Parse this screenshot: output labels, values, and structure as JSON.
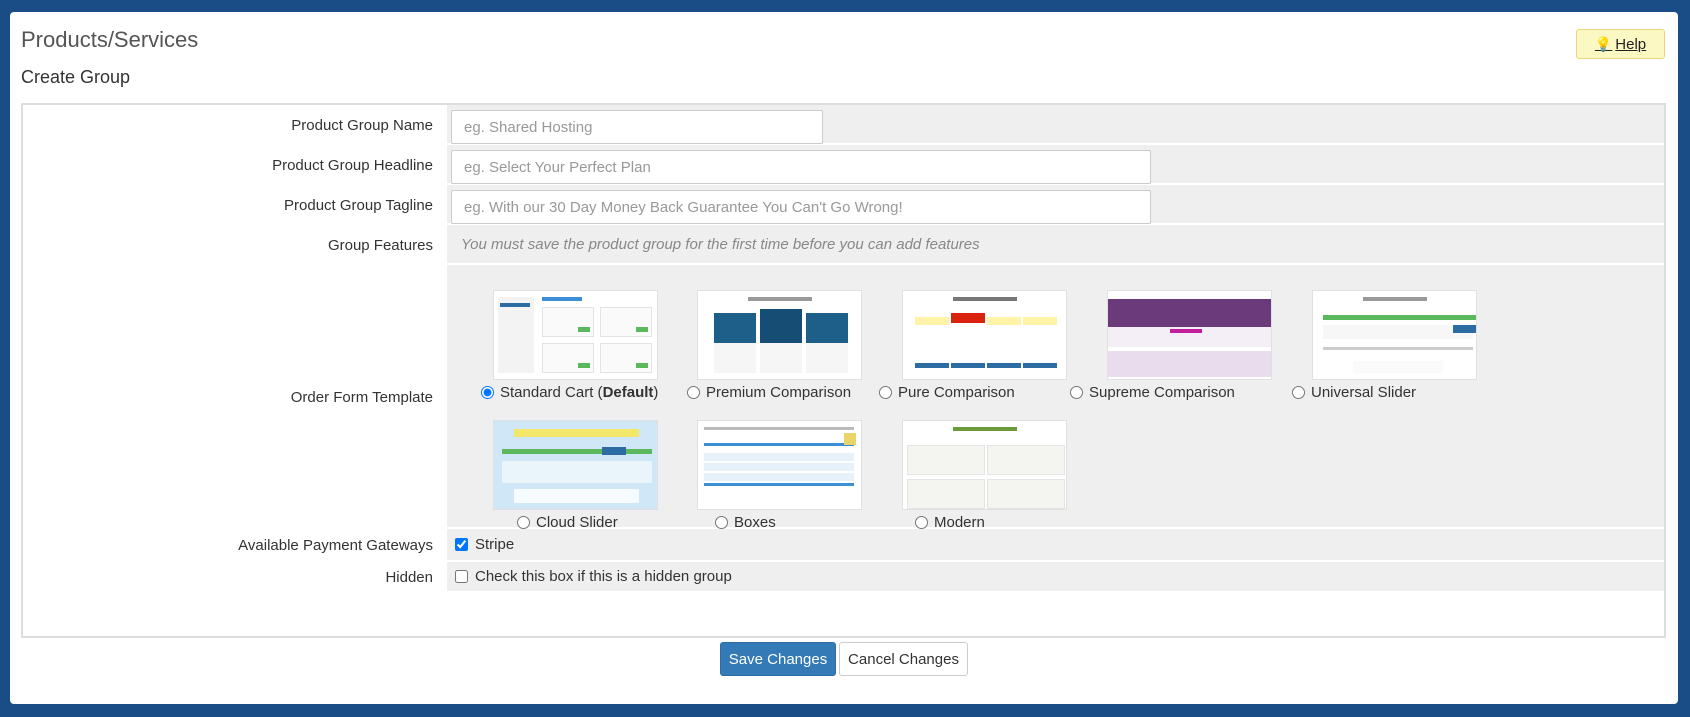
{
  "page": {
    "title": "Products/Services",
    "section_title": "Create Group"
  },
  "help": {
    "label": "Help",
    "icon": "lightbulb-icon"
  },
  "form": {
    "group_name": {
      "label": "Product Group Name",
      "value": "",
      "placeholder": "eg. Shared Hosting"
    },
    "headline": {
      "label": "Product Group Headline",
      "value": "",
      "placeholder": "eg. Select Your Perfect Plan"
    },
    "tagline": {
      "label": "Product Group Tagline",
      "value": "",
      "placeholder": "eg. With our 30 Day Money Back Guarantee You Can't Go Wrong!"
    },
    "features": {
      "label": "Group Features",
      "note": "You must save the product group for the first time before you can add features"
    },
    "order_form": {
      "label": "Order Form Template",
      "selected": "Standard Cart",
      "templates": [
        {
          "name": "Standard Cart",
          "suffix_open": " (",
          "suffix_bold": "Default",
          "suffix_close": ")"
        },
        {
          "name": "Premium Comparison"
        },
        {
          "name": "Pure Comparison"
        },
        {
          "name": "Supreme Comparison"
        },
        {
          "name": "Universal Slider"
        },
        {
          "name": "Cloud Slider"
        },
        {
          "name": "Boxes"
        },
        {
          "name": "Modern"
        }
      ]
    },
    "payment_gateways": {
      "label": "Available Payment Gateways",
      "options": [
        {
          "name": "Stripe",
          "checked": true
        }
      ]
    },
    "hidden": {
      "label": "Hidden",
      "checkbox_text": "Check this box if this is a hidden group",
      "checked": false
    }
  },
  "actions": {
    "save": "Save Changes",
    "cancel": "Cancel Changes"
  },
  "colors": {
    "background": "#1a4d86",
    "primary": "#337ab7",
    "help_bg": "#fcf8c4"
  }
}
